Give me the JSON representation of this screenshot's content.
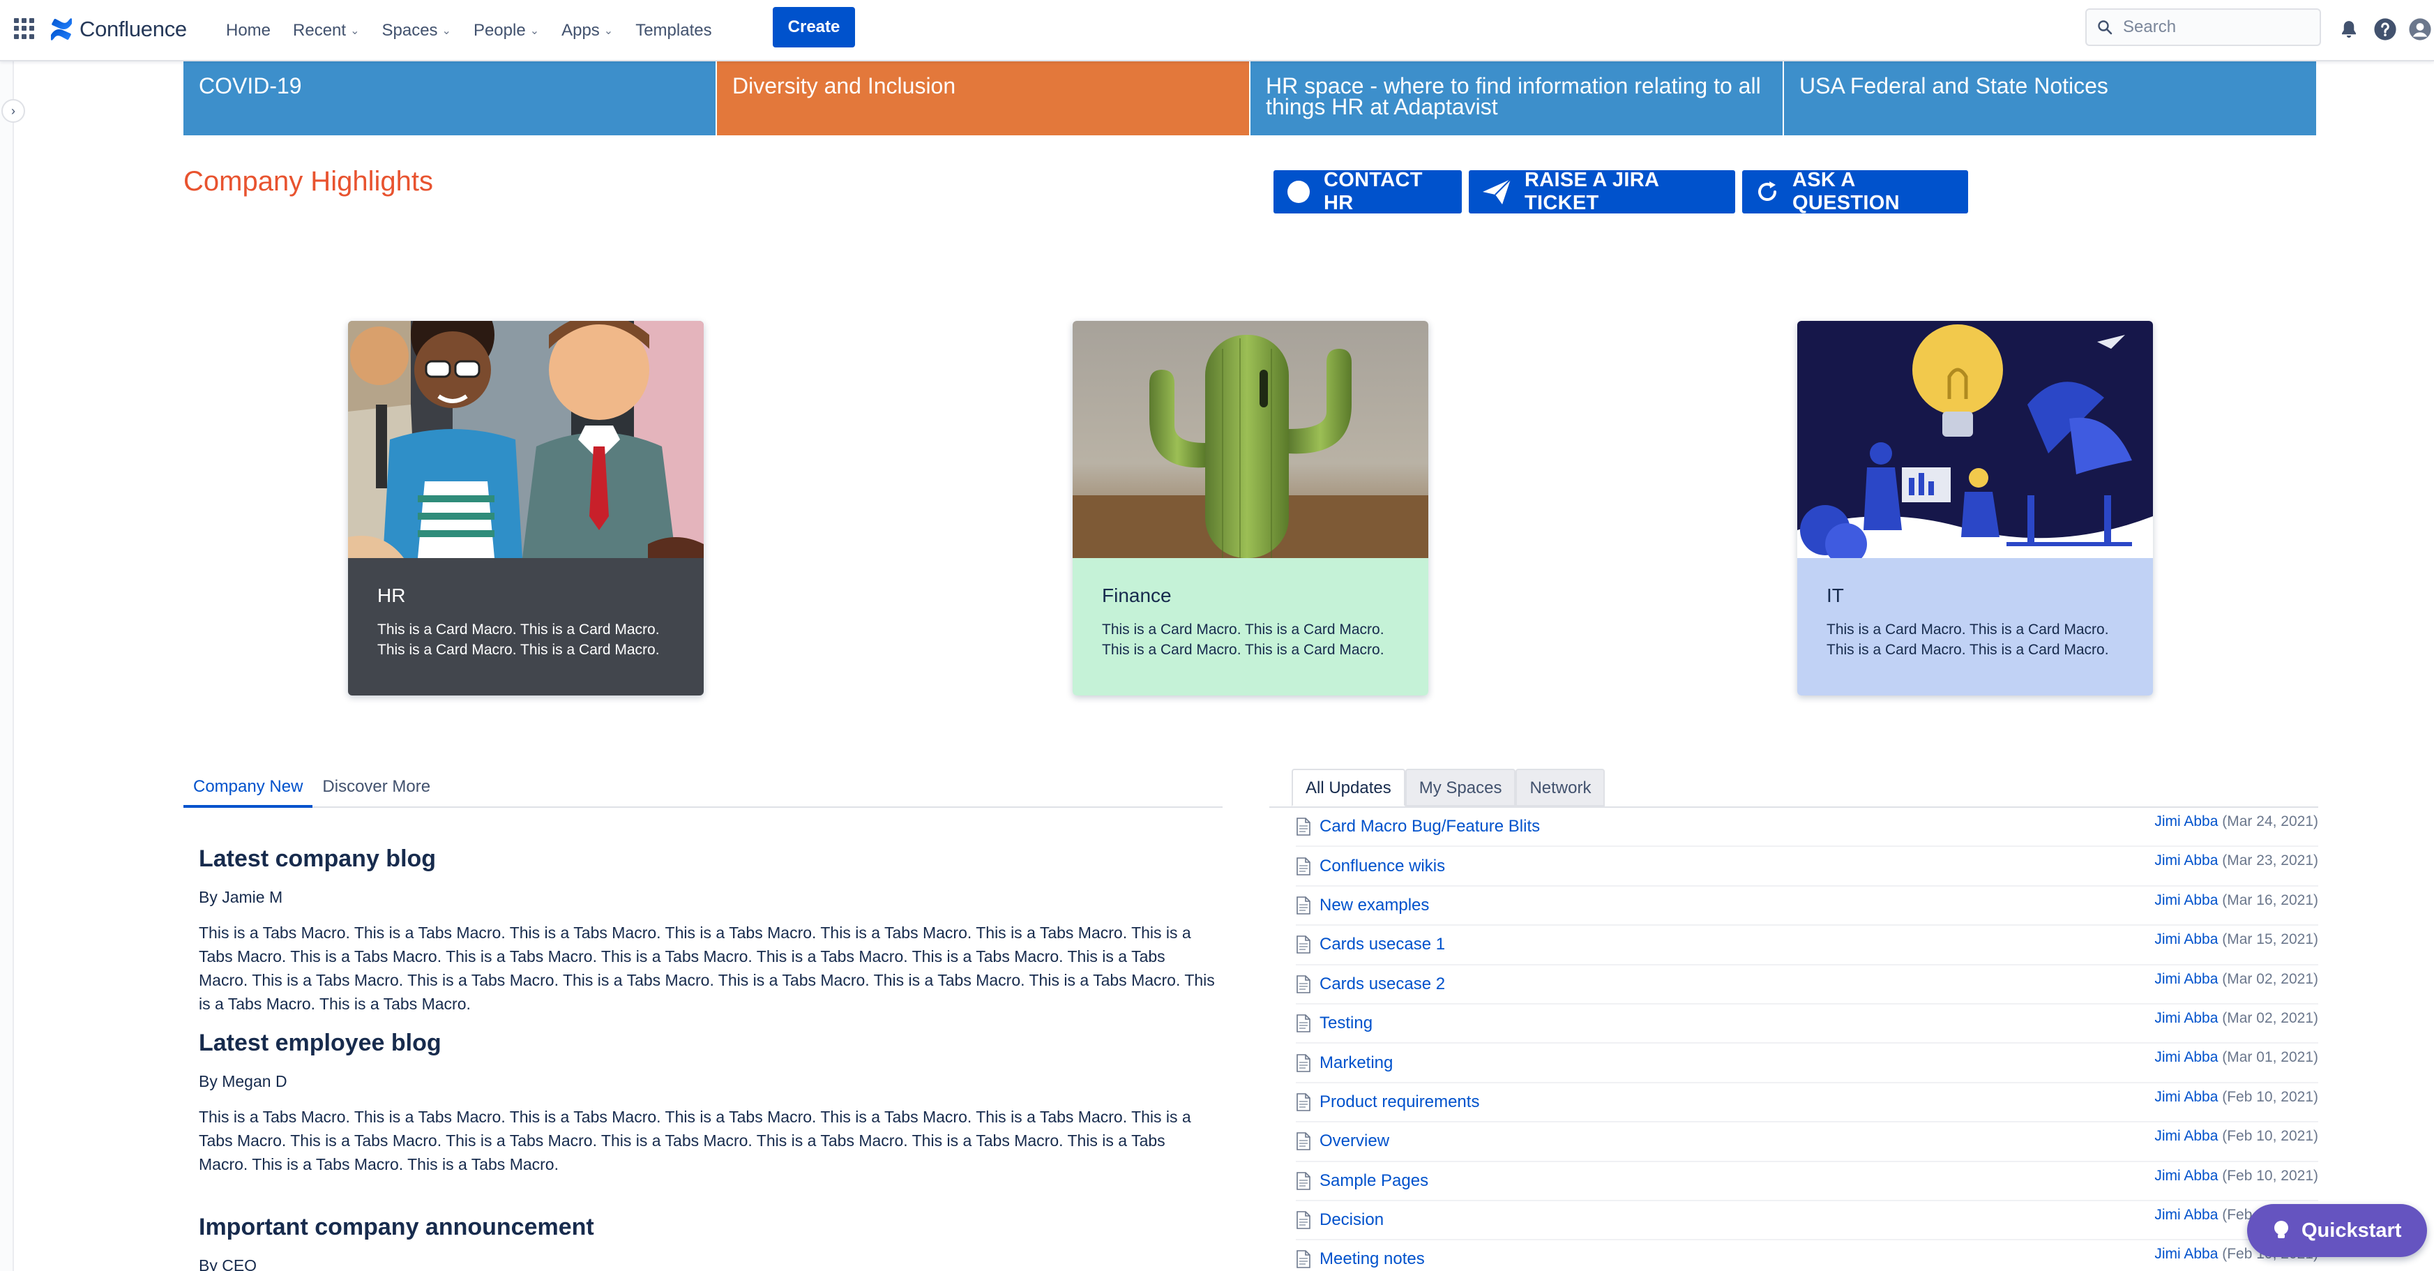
{
  "app": {
    "name": "Confluence"
  },
  "nav": {
    "items": [
      {
        "label": "Home",
        "dropdown": false
      },
      {
        "label": "Recent",
        "dropdown": true
      },
      {
        "label": "Spaces",
        "dropdown": true
      },
      {
        "label": "People",
        "dropdown": true
      },
      {
        "label": "Apps",
        "dropdown": true
      },
      {
        "label": "Templates",
        "dropdown": false
      }
    ],
    "create_label": "Create",
    "search_placeholder": "Search",
    "icons": [
      "notification-icon",
      "help-icon",
      "user-icon"
    ]
  },
  "banners": [
    {
      "label": "COVID-19",
      "color": "#3d8fcb"
    },
    {
      "label": "Diversity and Inclusion",
      "color": "#e3783b"
    },
    {
      "label": "HR space - where to find information relating to all things HR at Adaptavist",
      "color": "#3d8fcb"
    },
    {
      "label": "USA Federal and State Notices",
      "color": "#3d8fcb"
    }
  ],
  "highlights": {
    "title": "Company Highlights",
    "buttons": [
      {
        "label": "CONTACT HR",
        "icon": "circle-icon"
      },
      {
        "label": "RAISE A JIRA TICKET",
        "icon": "send-icon"
      },
      {
        "label": "ASK A QUESTION",
        "icon": "refresh-icon"
      }
    ]
  },
  "cards": [
    {
      "title": "HR",
      "text": "This is a Card Macro. This is a Card Macro. This is a Card Macro. This is a Card Macro.",
      "bg": "#42464d",
      "fg": "#ffffff"
    },
    {
      "title": "Finance",
      "text": "This is a Card Macro. This is a Card Macro. This is a Card Macro. This is a Card Macro.",
      "bg": "#c5f2d7",
      "fg": "#172b4d"
    },
    {
      "title": "IT",
      "text": "This is a Card Macro. This is a Card Macro. This is a Card Macro. This is a Card Macro.",
      "bg": "#c1d2f5",
      "fg": "#172b4d"
    }
  ],
  "left_tabs": [
    {
      "label": "Company New",
      "active": true
    },
    {
      "label": "Discover More",
      "active": false
    }
  ],
  "blogs": [
    {
      "title": "Latest company blog",
      "by": "By Jamie M",
      "text": "This is a Tabs Macro. This is a Tabs Macro. This is a Tabs Macro. This is a Tabs Macro. This is a Tabs Macro. This is a Tabs Macro. This is a Tabs Macro. This is a Tabs Macro. This is a Tabs Macro. This is a Tabs Macro. This is a Tabs Macro. This is a Tabs Macro. This is a Tabs Macro. This is a Tabs Macro. This is a Tabs Macro. This is a Tabs Macro. This is a Tabs Macro. This is a Tabs Macro. This is a Tabs Macro. This is a Tabs Macro. This is a Tabs Macro."
    },
    {
      "title": "Latest employee blog",
      "by": "By Megan D",
      "text": "This is a Tabs Macro. This is a Tabs Macro. This is a Tabs Macro. This is a Tabs Macro. This is a Tabs Macro. This is a Tabs Macro. This is a Tabs Macro. This is a Tabs Macro. This is a Tabs Macro. This is a Tabs Macro. This is a Tabs Macro. This is a Tabs Macro. This is a Tabs Macro. This is a Tabs Macro. This is a Tabs Macro."
    },
    {
      "title": "Important company announcement",
      "by": "By CEO",
      "text": ""
    }
  ],
  "right_tabs": [
    {
      "label": "All Updates",
      "active": true
    },
    {
      "label": "My Spaces",
      "active": false
    },
    {
      "label": "Network",
      "active": false
    }
  ],
  "updates": [
    {
      "title": "Card Macro Bug/Feature Blits",
      "author": "Jimi Abba",
      "date": "(Mar 24, 2021)"
    },
    {
      "title": "Confluence wikis",
      "author": "Jimi Abba",
      "date": "(Mar 23, 2021)"
    },
    {
      "title": "New examples",
      "author": "Jimi Abba",
      "date": "(Mar 16, 2021)"
    },
    {
      "title": "Cards usecase 1",
      "author": "Jimi Abba",
      "date": "(Mar 15, 2021)"
    },
    {
      "title": "Cards usecase 2",
      "author": "Jimi Abba",
      "date": "(Mar 02, 2021)"
    },
    {
      "title": "Testing",
      "author": "Jimi Abba",
      "date": "(Mar 02, 2021)"
    },
    {
      "title": "Marketing",
      "author": "Jimi Abba",
      "date": "(Mar 01, 2021)"
    },
    {
      "title": "Product requirements",
      "author": "Jimi Abba",
      "date": "(Feb 10, 2021)"
    },
    {
      "title": "Overview",
      "author": "Jimi Abba",
      "date": "(Feb 10, 2021)"
    },
    {
      "title": "Sample Pages",
      "author": "Jimi Abba",
      "date": "(Feb 10, 2021)"
    },
    {
      "title": "Decision",
      "author": "Jimi Abba",
      "date": "(Feb 10, 2021)"
    },
    {
      "title": "Meeting notes",
      "author": "Jimi Abba",
      "date": "(Feb 10, 2021)"
    }
  ],
  "quickstart": {
    "label": "Quickstart"
  }
}
